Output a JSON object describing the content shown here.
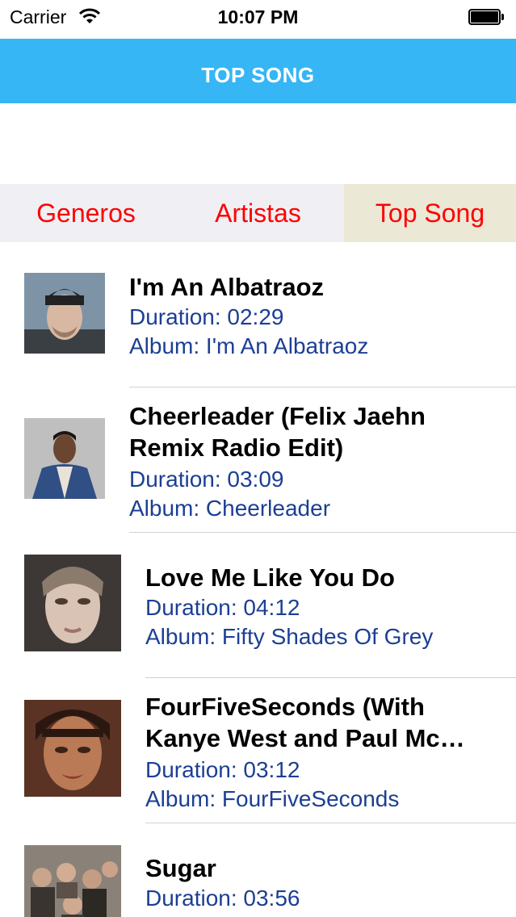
{
  "status_bar": {
    "carrier": "Carrier",
    "time": "10:07 PM"
  },
  "nav": {
    "title": "TOP SONG",
    "color": "#36b6f5"
  },
  "tabs": [
    {
      "label": "Generos",
      "active": false
    },
    {
      "label": "Artistas",
      "active": false
    },
    {
      "label": "Top Song",
      "active": true
    }
  ],
  "songs": [
    {
      "title_lines": [
        "I'm An Albatraoz"
      ],
      "duration": "Duration: 02:29",
      "album": "Album: I'm An Albatraoz"
    },
    {
      "title_lines": [
        "Cheerleader (Felix Jaehn",
        "Remix Radio Edit)"
      ],
      "duration": "Duration: 03:09",
      "album": "Album: Cheerleader"
    },
    {
      "title_lines": [
        "Love Me Like You Do"
      ],
      "duration": "Duration: 04:12",
      "album": "Album: Fifty Shades Of Grey"
    },
    {
      "title_lines": [
        "FourFiveSeconds  (With",
        "Kanye West and Paul Mc…"
      ],
      "duration": "Duration: 03:12",
      "album": "Album: FourFiveSeconds"
    },
    {
      "title_lines": [
        "Sugar"
      ],
      "duration": "Duration: 03:56",
      "album": ""
    }
  ]
}
